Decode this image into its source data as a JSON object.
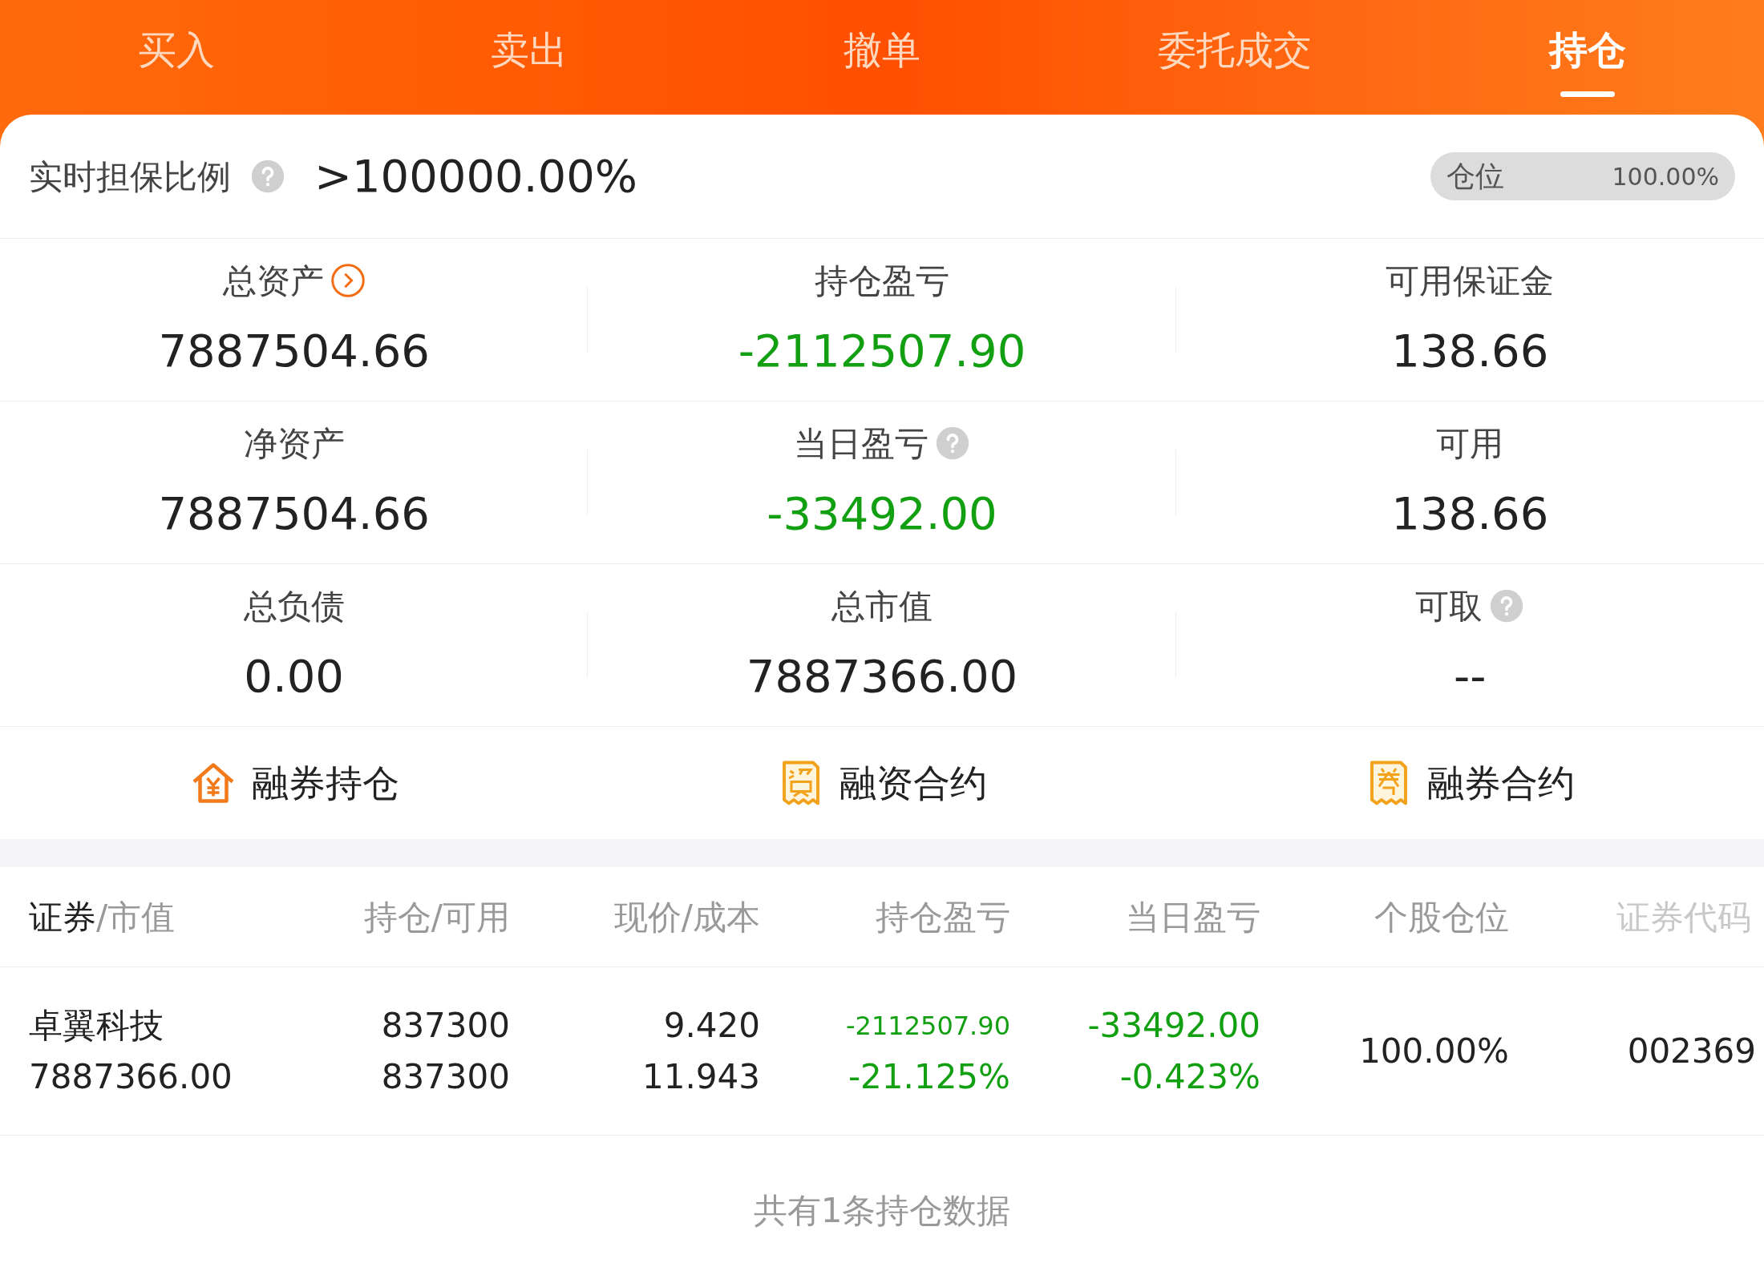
{
  "tabs": [
    {
      "label": "买入",
      "selected": false
    },
    {
      "label": "卖出",
      "selected": false
    },
    {
      "label": "撤单",
      "selected": false
    },
    {
      "label": "委托成交",
      "selected": false
    },
    {
      "label": "持仓",
      "selected": true
    }
  ],
  "ratio": {
    "label": "实时担保比例",
    "value": ">100000.00%",
    "position": {
      "label": "仓位",
      "reading": "100.00%"
    }
  },
  "stats": [
    {
      "label": "总资产",
      "kind": "link",
      "value": "7887504.66",
      "color": "#222222"
    },
    {
      "label": "持仓盈亏",
      "kind": "plain",
      "value": "-2112507.90",
      "color": "#12a012"
    },
    {
      "label": "可用保证金",
      "kind": "plain",
      "value": "138.66",
      "color": "#222222"
    },
    {
      "label": "净资产",
      "kind": "plain",
      "value": "7887504.66",
      "color": "#222222"
    },
    {
      "label": "当日盈亏",
      "kind": "help",
      "value": "-33492.00",
      "color": "#12a012"
    },
    {
      "label": "可用",
      "kind": "plain",
      "value": "138.66",
      "color": "#222222"
    },
    {
      "label": "总负债",
      "kind": "plain",
      "value": "0.00",
      "color": "#222222"
    },
    {
      "label": "总市值",
      "kind": "plain",
      "value": "7887366.00",
      "color": "#222222"
    },
    {
      "label": "可取",
      "kind": "help",
      "value": "--",
      "color": "#222222"
    }
  ],
  "shortcuts": [
    {
      "label": "融券持仓",
      "kind": "house"
    },
    {
      "label": "融资合约",
      "kind": "zi"
    },
    {
      "label": "融券合约",
      "kind": "quan"
    }
  ],
  "table": {
    "columns": [
      {
        "main": "证券",
        "rest": "/市值"
      },
      {
        "rest": "持仓/可用"
      },
      {
        "rest": "现价/成本"
      },
      {
        "rest": "持仓盈亏"
      },
      {
        "rest": "当日盈亏"
      },
      {
        "rest": "个股仓位"
      },
      {
        "rest": "证券代码"
      }
    ],
    "rows": [
      {
        "cells": [
          {
            "lines": [
              "卓翼科技",
              "7887366.00"
            ],
            "color": "#222222"
          },
          {
            "lines": [
              "837300",
              "837300"
            ],
            "color": "#222222"
          },
          {
            "lines": [
              "9.420",
              "11.943"
            ],
            "color": "#222222"
          },
          {
            "lines": [
              "-2112507.90",
              "-21.125%"
            ],
            "color": "#12a012"
          },
          {
            "lines": [
              "-33492.00",
              "-0.423%"
            ],
            "color": "#12a012"
          },
          {
            "lines": [
              "100.00%"
            ],
            "color": "#222222"
          },
          {
            "lines": [
              "002369"
            ],
            "color": "#222222"
          }
        ]
      }
    ]
  },
  "footer": "共有1条持仓数据"
}
